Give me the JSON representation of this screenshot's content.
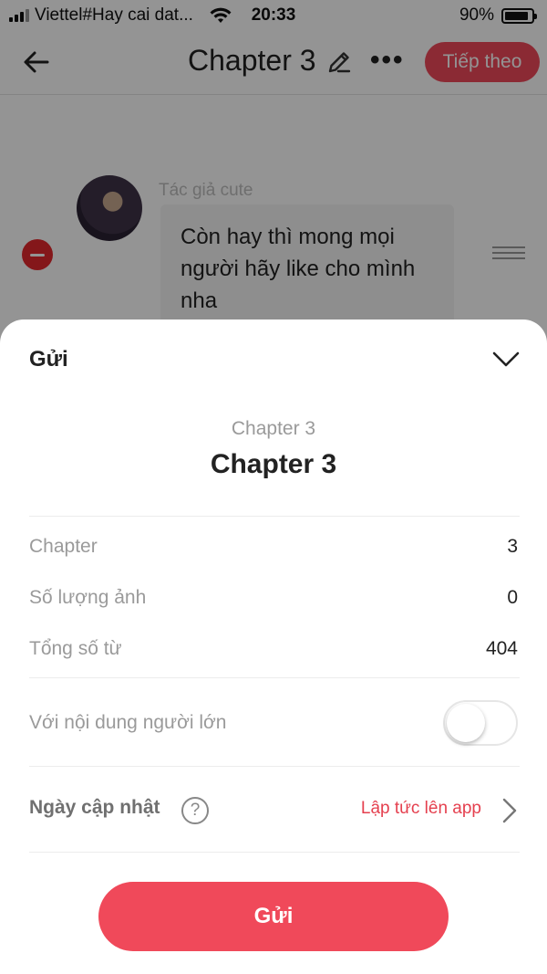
{
  "status_bar": {
    "carrier": "Viettel#Hay cai dat...",
    "time": "20:33",
    "battery": "90%",
    "battery_level": 0.9
  },
  "nav": {
    "back_icon": "arrow-left-icon",
    "title": "Chapter 3",
    "edit_icon": "pencil-icon",
    "more_label": "•••",
    "next_label": "Tiếp theo"
  },
  "content": {
    "author": "Tác giả cute",
    "message": "Còn hay thì mong mọi người hãy like cho mình nha"
  },
  "sheet": {
    "title": "Gửi",
    "collapse_icon": "chevron-down-icon",
    "subtitle": "Chapter 3",
    "heading": "Chapter 3",
    "rows": [
      {
        "label": "Chapter",
        "value": "3"
      },
      {
        "label": "Số lượng ảnh",
        "value": "0"
      },
      {
        "label": "Tổng số từ",
        "value": "404"
      }
    ],
    "adult_label": "Với nội dung người lớn",
    "adult_enabled": false,
    "date_label": "Ngày cập nhật",
    "help_symbol": "?",
    "date_value": "Lập tức lên app",
    "submit_label": "Gửi"
  },
  "colors": {
    "accent": "#f0495a",
    "link": "#e5404f",
    "muted": "#9a9a9a"
  }
}
